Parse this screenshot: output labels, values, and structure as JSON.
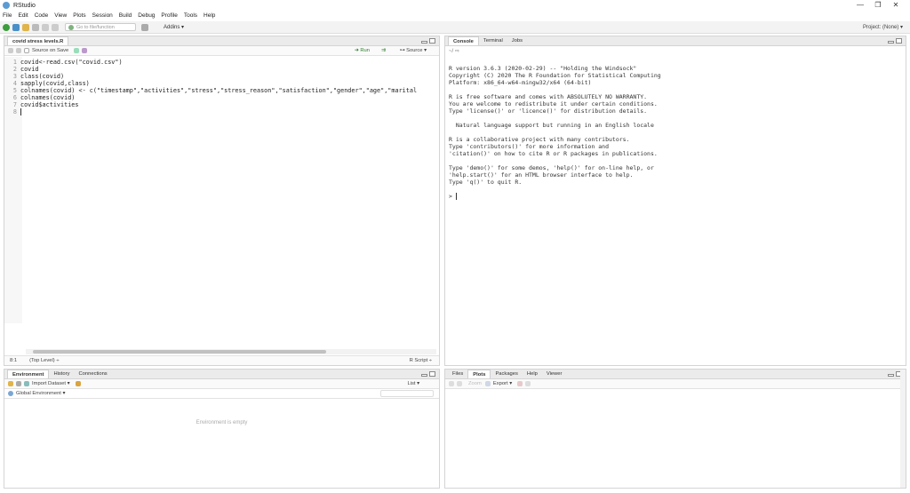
{
  "window": {
    "title": "RStudio",
    "controls": [
      "—",
      "❐",
      "✕"
    ]
  },
  "menu": [
    "File",
    "Edit",
    "Code",
    "View",
    "Plots",
    "Session",
    "Build",
    "Debug",
    "Profile",
    "Tools",
    "Help"
  ],
  "toolbar": {
    "goto_placeholder": "Go to file/function",
    "addins": "Addins ▾",
    "project": "Project: (None) ▾"
  },
  "editor": {
    "tab": "covid stress levels.R",
    "source_on_save": "Source on Save",
    "run": "➜ Run",
    "source": "⊶ Source ▾",
    "lines": [
      {
        "n": "1",
        "code": "covid<-read.csv(\"covid.csv\")"
      },
      {
        "n": "2",
        "code": "covid"
      },
      {
        "n": "3",
        "code": "class(covid)"
      },
      {
        "n": "4",
        "code": "sapply(covid,class)"
      },
      {
        "n": "5",
        "code": "colnames(covid) <- c(\"timestamp\",\"activities\",\"stress\",\"stress_reason\",\"satisfaction\",\"gender\",\"age\",\"marital"
      },
      {
        "n": "6",
        "code": "colnames(covid)"
      },
      {
        "n": "7",
        "code": "covid$activities"
      },
      {
        "n": "8",
        "code": ""
      }
    ],
    "status_pos": "8:1",
    "status_scope": "(Top Level) ÷",
    "status_type": "R Script ÷"
  },
  "console": {
    "tabs": [
      "Console",
      "Terminal",
      "Jobs"
    ],
    "cwd": "~/ ⇨",
    "output": "R version 3.6.3 (2020-02-29) -- \"Holding the Windsock\"\nCopyright (C) 2020 The R Foundation for Statistical Computing\nPlatform: x86_64-w64-mingw32/x64 (64-bit)\n\nR is free software and comes with ABSOLUTELY NO WARRANTY.\nYou are welcome to redistribute it under certain conditions.\nType 'license()' or 'licence()' for distribution details.\n\n  Natural language support but running in an English locale\n\nR is a collaborative project with many contributors.\nType 'contributors()' for more information and\n'citation()' on how to cite R or R packages in publications.\n\nType 'demo()' for some demos, 'help()' for on-line help, or\n'help.start()' for an HTML browser interface to help.\nType 'q()' to quit R.\n\n",
    "prompt": "> "
  },
  "environment": {
    "tabs": [
      "Environment",
      "History",
      "Connections"
    ],
    "import_dataset": "Import Dataset ▾",
    "list": "List ▾",
    "global_env": "Global Environment ▾",
    "empty": "Environment is empty"
  },
  "files": {
    "tabs": [
      "Files",
      "Plots",
      "Packages",
      "Help",
      "Viewer"
    ],
    "zoom": "Zoom",
    "export": "Export ▾"
  }
}
